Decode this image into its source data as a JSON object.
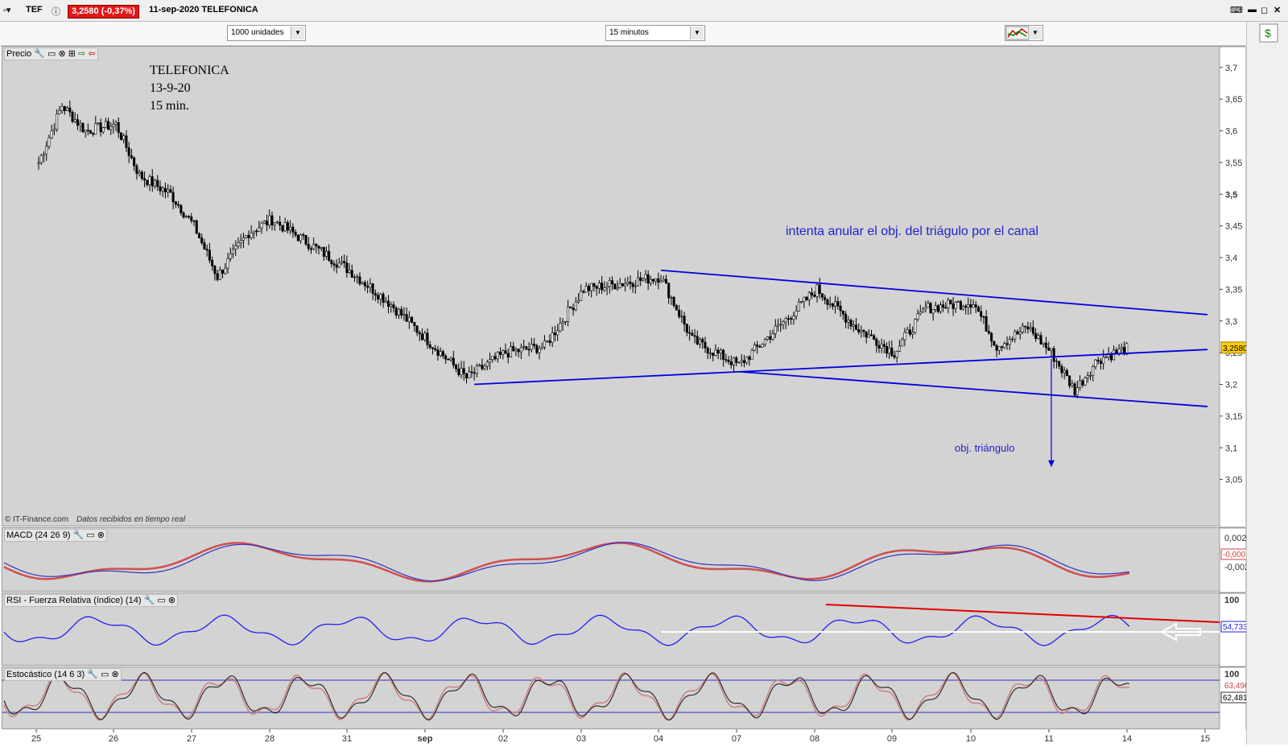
{
  "titlebar": {
    "ticker": "TEF",
    "price_badge": "3,2580 (-0,37%)",
    "date_name": "11-sep-2020 TELEFONICA"
  },
  "toolbar": {
    "units_select": "1000 unidades",
    "interval_select": "15 minutos"
  },
  "price_panel": {
    "label": "Precio",
    "annotation_title": "TELEFONICA",
    "annotation_date": "13-9-20",
    "annotation_interval": "15 min.",
    "annotation_channel": "intenta anular el obj. del triágulo por el canal",
    "annotation_target": "obj. triángulo",
    "copyright": "© IT-Finance.com",
    "realtime_note": "Datos recibidos en tiempo real",
    "last_price_label": "3,2580",
    "colors": {
      "lines": "#0000dd",
      "last_price_bg": "#ffcc00"
    }
  },
  "macd_panel": {
    "label": "MACD (24 26 9)",
    "ticks": [
      "0,002",
      "-0,00025",
      "-0,002"
    ]
  },
  "rsi_panel": {
    "label": "RSI - Fuerza Relativa (índice) (14)",
    "ticks": [
      "100",
      "54,733"
    ]
  },
  "stoch_panel": {
    "label": "Estocástico (14 6 3)",
    "ticks": [
      "100",
      "63,496",
      "62,481"
    ]
  },
  "chart_data": {
    "type": "candlestick",
    "title": "TELEFONICA",
    "x_labels": [
      "25",
      "26",
      "27",
      "28",
      "31",
      "sep",
      "02",
      "03",
      "04",
      "07",
      "08",
      "09",
      "10",
      "11",
      "14",
      "15"
    ],
    "y_ticks": [
      "3,7",
      "3,65",
      "3,6",
      "3,55",
      "3,5",
      "3,45",
      "3,4",
      "3,35",
      "3,3",
      "3,25",
      "3,2",
      "3,15",
      "3,1",
      "3,05"
    ],
    "ylim": [
      3.0,
      3.72
    ],
    "last": 3.258,
    "close_path": [
      {
        "x": "25",
        "y": 3.55
      },
      {
        "x": "25.3",
        "y": 3.64
      },
      {
        "x": "25.6",
        "y": 3.6
      },
      {
        "x": "26",
        "y": 3.61
      },
      {
        "x": "26.3",
        "y": 3.53
      },
      {
        "x": "26.7",
        "y": 3.5
      },
      {
        "x": "27",
        "y": 3.45
      },
      {
        "x": "27.3",
        "y": 3.37
      },
      {
        "x": "27.7",
        "y": 3.44
      },
      {
        "x": "28",
        "y": 3.46
      },
      {
        "x": "28.5",
        "y": 3.42
      },
      {
        "x": "31",
        "y": 3.38
      },
      {
        "x": "31.5",
        "y": 3.33
      },
      {
        "x": "sep",
        "y": 3.27
      },
      {
        "x": "sep.5",
        "y": 3.21
      },
      {
        "x": "02",
        "y": 3.25
      },
      {
        "x": "02.5",
        "y": 3.26
      },
      {
        "x": "03",
        "y": 3.35
      },
      {
        "x": "03.5",
        "y": 3.36
      },
      {
        "x": "04",
        "y": 3.37
      },
      {
        "x": "04.4",
        "y": 3.27
      },
      {
        "x": "07",
        "y": 3.23
      },
      {
        "x": "07.5",
        "y": 3.29
      },
      {
        "x": "08",
        "y": 3.35
      },
      {
        "x": "08.5",
        "y": 3.29
      },
      {
        "x": "09",
        "y": 3.25
      },
      {
        "x": "09.4",
        "y": 3.32
      },
      {
        "x": "10",
        "y": 3.33
      },
      {
        "x": "10.3",
        "y": 3.26
      },
      {
        "x": "10.7",
        "y": 3.29
      },
      {
        "x": "11",
        "y": 3.25
      },
      {
        "x": "11.3",
        "y": 3.19
      },
      {
        "x": "11.6",
        "y": 3.24
      },
      {
        "x": "14",
        "y": 3.258
      }
    ],
    "trendlines": [
      {
        "name": "upper channel",
        "from": {
          "x": "04",
          "y": 3.38
        },
        "to": {
          "x": "15",
          "y": 3.31
        }
      },
      {
        "name": "triangle support",
        "from": {
          "x": "sep.6",
          "y": 3.2
        },
        "to": {
          "x": "15",
          "y": 3.255
        }
      },
      {
        "name": "lower channel",
        "from": {
          "x": "07",
          "y": 3.22
        },
        "to": {
          "x": "15",
          "y": 3.165
        }
      }
    ],
    "target_arrow": {
      "x": "11",
      "from": 3.24,
      "to": 3.07
    }
  }
}
